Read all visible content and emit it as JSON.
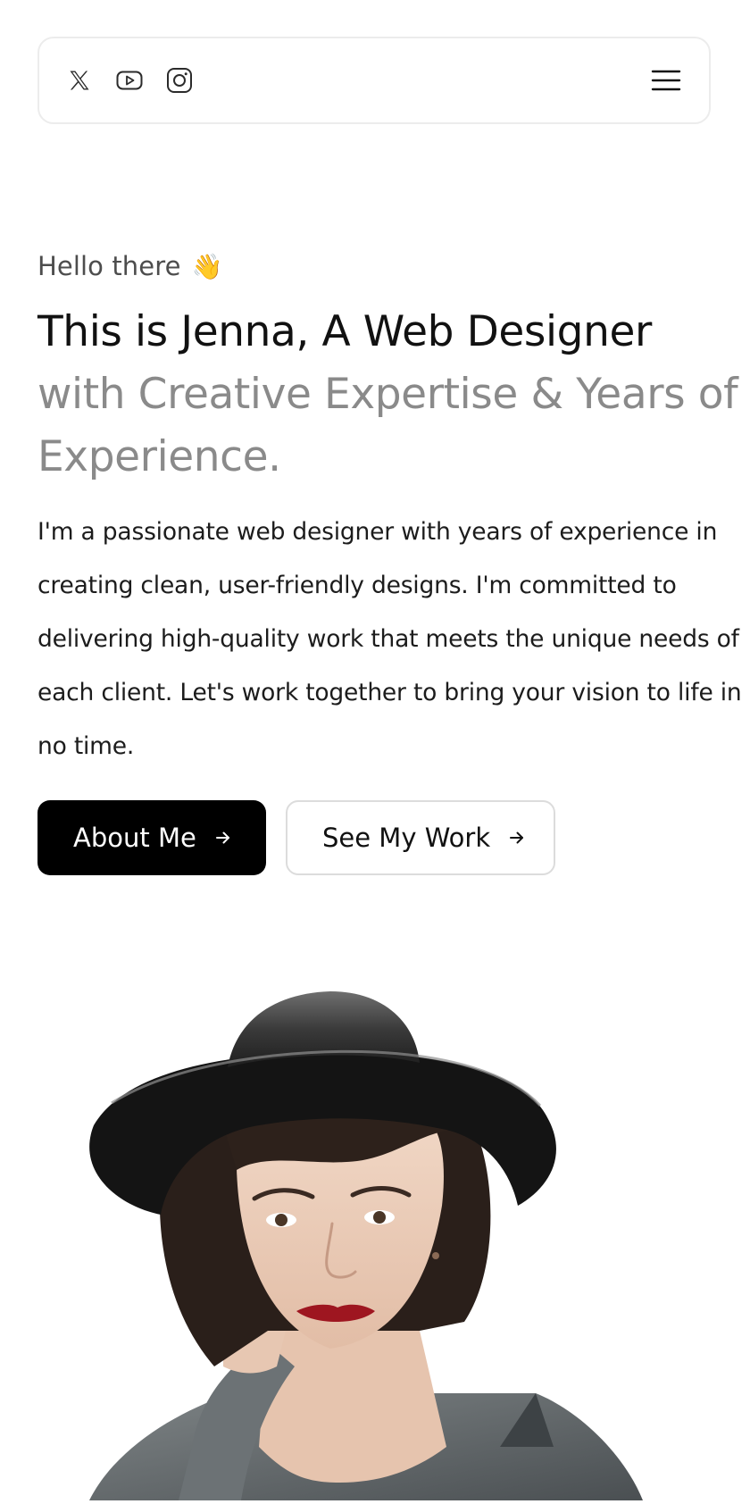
{
  "nav": {
    "social_icons": [
      "x-twitter-icon",
      "youtube-icon",
      "instagram-icon"
    ],
    "menu_icon": "hamburger-menu-icon"
  },
  "hero": {
    "greeting": "Hello there",
    "greeting_emoji": "👋",
    "headline_dark": "This is Jenna, A Web Designer",
    "headline_muted": "with Creative Expertise & Years of Experience.",
    "bio": "I'm a passionate web designer with years of experience in creating clean, user-friendly designs. I'm committed to delivering high-quality work that meets the unique needs of each client. Let's work together to bring your vision to life in no time.",
    "primary_button": "About Me",
    "secondary_button": "See My Work",
    "button_arrow_icon": "arrow-right-icon"
  },
  "colors": {
    "text": "#111111",
    "muted_text": "#8a8a8a",
    "primary_button_bg": "#000000",
    "border": "#ececec"
  }
}
